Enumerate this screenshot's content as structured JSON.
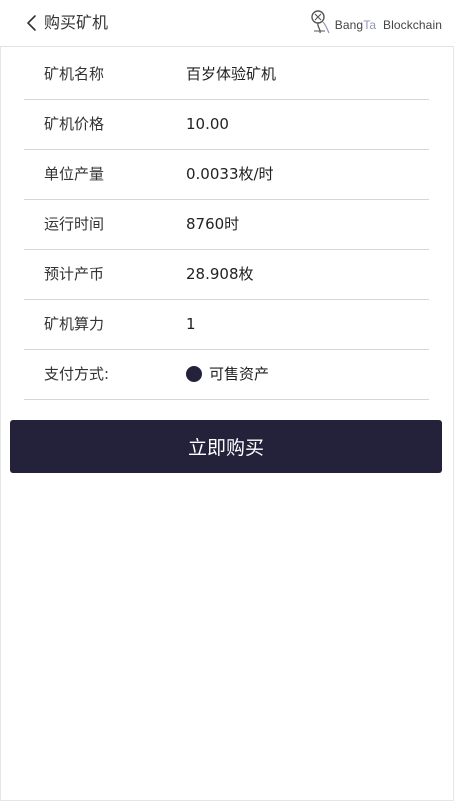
{
  "header": {
    "back_icon": "chevron-left-icon",
    "title": "购买矿机",
    "brand": {
      "logo_icon": "bangta-logo-icon",
      "name_part1": "Bang",
      "name_part2": "Ta",
      "name_part3": "Blockchain",
      "accent_color": "#8f97b3"
    }
  },
  "details": [
    {
      "label": "矿机名称",
      "value": "百岁体验矿机"
    },
    {
      "label": "矿机价格",
      "value": "10.00"
    },
    {
      "label": "单位产量",
      "value": "0.0033枚/时"
    },
    {
      "label": "运行时间",
      "value": "8760时"
    },
    {
      "label": "预计产币",
      "value": "28.908枚"
    },
    {
      "label": "矿机算力",
      "value": "1"
    }
  ],
  "payment": {
    "label": "支付方式:",
    "option_label": "可售资产",
    "selected": true
  },
  "buy_button_label": "立即购买",
  "colors": {
    "primary": "#24213b",
    "divider": "#d6d6d6"
  }
}
